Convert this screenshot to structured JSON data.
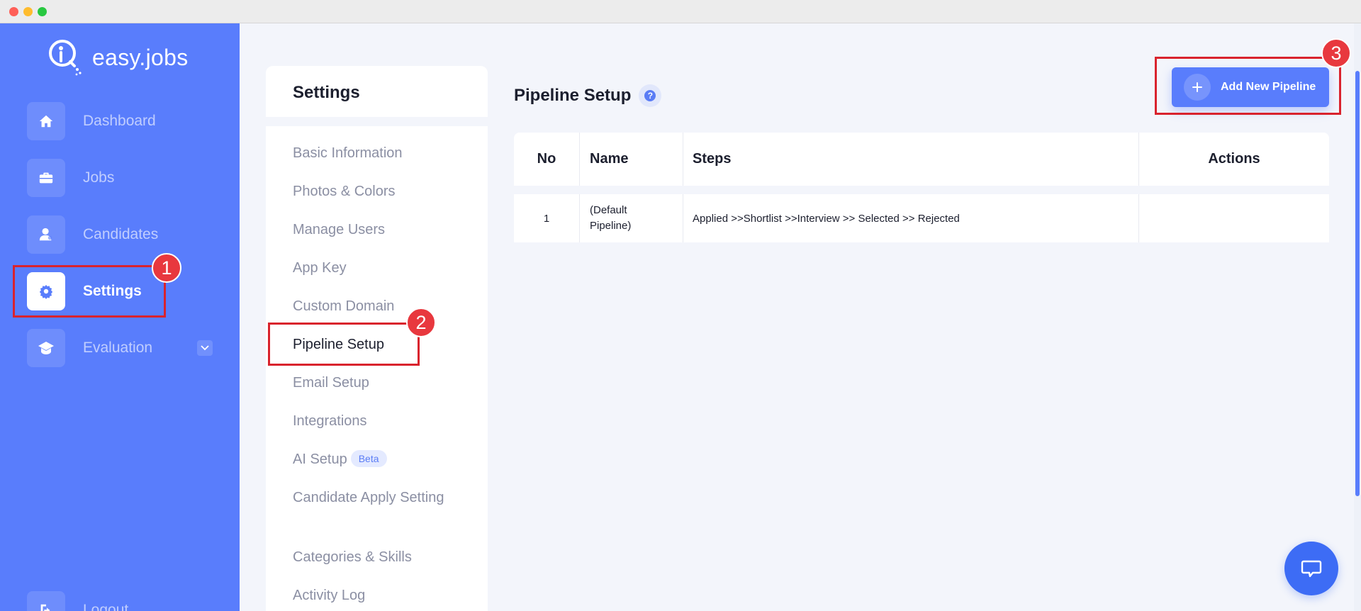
{
  "app": {
    "brand": "easy.jobs",
    "accent_color": "#597dfc",
    "highlight_color": "#d9232d"
  },
  "sidebar": {
    "items": [
      {
        "label": "Dashboard",
        "icon": "home-icon"
      },
      {
        "label": "Jobs",
        "icon": "briefcase-icon"
      },
      {
        "label": "Candidates",
        "icon": "user-icon"
      },
      {
        "label": "Settings",
        "icon": "gear-icon",
        "active": true
      },
      {
        "label": "Evaluation",
        "icon": "graduation-cap-icon",
        "expandable": true
      }
    ],
    "logout_label": "Logout"
  },
  "settings": {
    "title": "Settings",
    "menu": [
      {
        "label": "Basic Information"
      },
      {
        "label": "Photos & Colors"
      },
      {
        "label": "Manage Users"
      },
      {
        "label": "App Key"
      },
      {
        "label": "Custom Domain"
      },
      {
        "label": "Pipeline Setup",
        "active": true
      },
      {
        "label": "Email Setup"
      },
      {
        "label": "Integrations"
      },
      {
        "label": "AI Setup",
        "badge": "Beta"
      },
      {
        "label": "Candidate Apply Setting"
      },
      {
        "label": "Categories & Skills"
      },
      {
        "label": "Activity Log"
      }
    ]
  },
  "main": {
    "title": "Pipeline Setup",
    "help_symbol": "?",
    "add_button_label": "Add New Pipeline",
    "table": {
      "headers": [
        "No",
        "Name",
        "Steps",
        "Actions"
      ],
      "rows": [
        {
          "no": "1",
          "name_line1": "(Default",
          "name_line2": "Pipeline)",
          "steps": "Applied >>Shortlist >>Interview >> Selected >> Rejected",
          "actions": ""
        }
      ]
    }
  },
  "annotations": [
    "1",
    "2",
    "3"
  ]
}
